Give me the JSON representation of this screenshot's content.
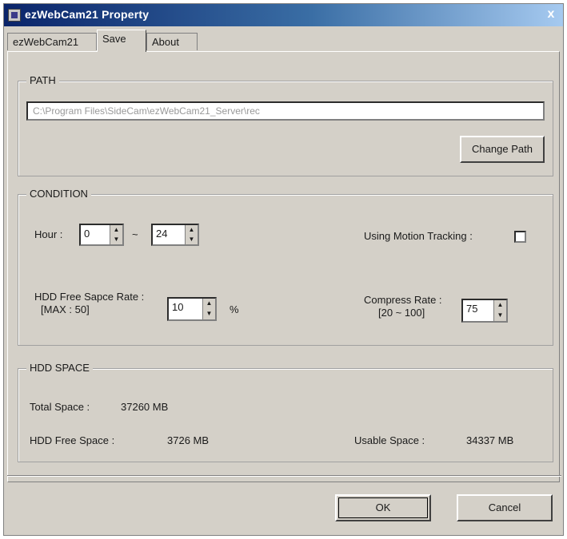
{
  "window": {
    "title": "ezWebCam21 Property",
    "close_glyph": "x"
  },
  "tabs": [
    {
      "label": "ezWebCam21",
      "active": false
    },
    {
      "label": "Save",
      "active": true
    },
    {
      "label": "About",
      "active": false
    }
  ],
  "path_group": {
    "label": "PATH",
    "path_value": "C:\\Program Files\\SideCam\\ezWebCam21_Server\\rec",
    "change_path_button": "Change Path"
  },
  "condition_group": {
    "label": "CONDITION",
    "hour_label": "Hour :",
    "hour_from": "0",
    "hour_dash": "~",
    "hour_to": "24",
    "motion_tracking_label": "Using Motion Tracking :",
    "motion_tracking_checked": false,
    "hdd_free_label": "HDD Free Sapce Rate :",
    "hdd_free_max": "[MAX : 50]",
    "hdd_free_value": "10",
    "hdd_free_unit": "%",
    "compress_label": "Compress Rate :",
    "compress_range": "[20 ~ 100]",
    "compress_value": "75"
  },
  "hdd_group": {
    "label": "HDD SPACE",
    "total_label": "Total Space :",
    "total_value": "37260 MB",
    "free_label": "HDD Free Space :",
    "free_value": "3726 MB",
    "usable_label": "Usable Space :",
    "usable_value": "34337 MB"
  },
  "buttons": {
    "ok": "OK",
    "cancel": "Cancel"
  }
}
